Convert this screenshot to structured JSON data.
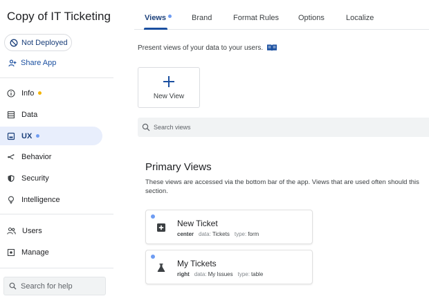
{
  "app": {
    "title": "Copy of IT Ticketing"
  },
  "deploy": {
    "label": "Not Deployed"
  },
  "share": {
    "label": "Share App"
  },
  "nav": {
    "items": [
      {
        "label": "Info",
        "dot": true,
        "dot_color": "#f4b400"
      },
      {
        "label": "Data",
        "dot": false
      },
      {
        "label": "UX",
        "dot": true,
        "dot_color": "#6e9cf2",
        "active": true
      },
      {
        "label": "Behavior",
        "dot": false
      },
      {
        "label": "Security",
        "dot": false
      },
      {
        "label": "Intelligence",
        "dot": false
      },
      {
        "label": "Users",
        "dot": false
      },
      {
        "label": "Manage",
        "dot": false
      }
    ]
  },
  "help_search": {
    "placeholder": "Search for help"
  },
  "tabs": [
    {
      "label": "Views",
      "active": true,
      "dot": true
    },
    {
      "label": "Brand"
    },
    {
      "label": "Format Rules"
    },
    {
      "label": "Options"
    },
    {
      "label": "Localize"
    }
  ],
  "main": {
    "description": "Present views of your data to your users.",
    "new_view_label": "New View",
    "search_placeholder": "Search views",
    "section_title": "Primary Views",
    "section_desc": "These views are accessed via the bottom bar of the app. Views that are used often should this section."
  },
  "views": [
    {
      "name": "New Ticket",
      "position": "center",
      "data_key": "data:",
      "data": "Tickets",
      "type_key": "type:",
      "type": "form",
      "icon": "plus-box-icon"
    },
    {
      "name": "My Tickets",
      "position": "right",
      "data_key": "data:",
      "data": "My Issues",
      "type_key": "type:",
      "type": "table",
      "icon": "flask-icon"
    }
  ],
  "colors": {
    "accent": "#1a4fa0",
    "dot_blue": "#6e9cf2",
    "dot_yellow": "#f4b400",
    "active_nav_bg": "#e8eefc"
  }
}
